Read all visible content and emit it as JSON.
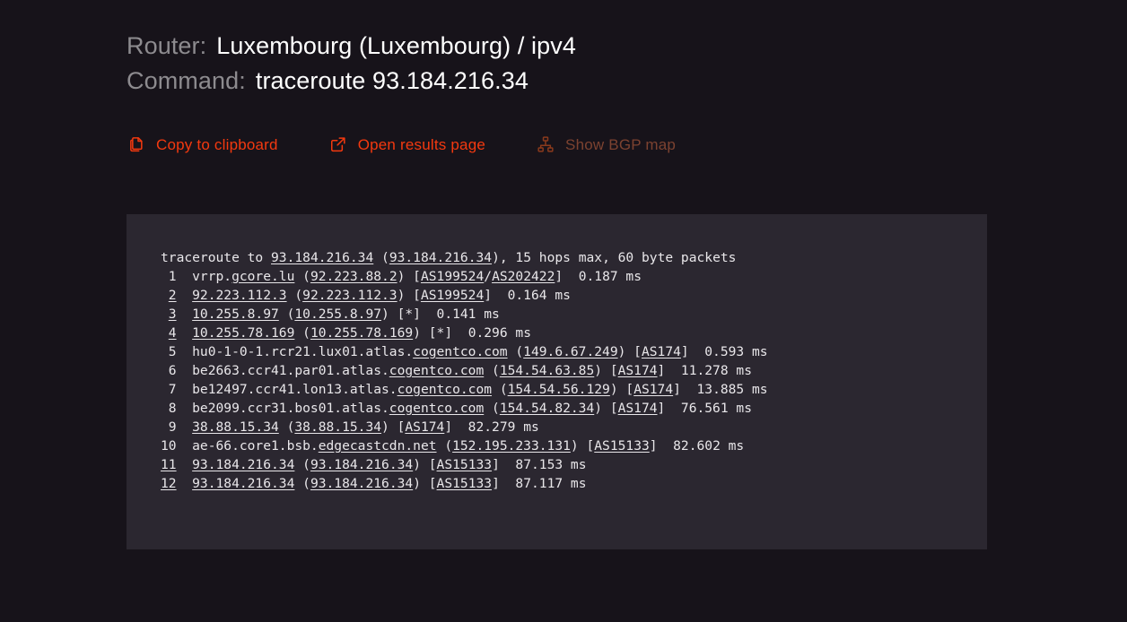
{
  "header": {
    "router_label": "Router:",
    "router_value": "Luxembourg (Luxembourg) / ipv4",
    "command_label": "Command:",
    "command_value": "traceroute 93.184.216.34"
  },
  "actions": [
    {
      "id": "copy-to-clipboard",
      "label": "Copy to clipboard",
      "icon": "copy-icon",
      "enabled": true
    },
    {
      "id": "open-results-page",
      "label": "Open results page",
      "icon": "external-link-icon",
      "enabled": true
    },
    {
      "id": "show-bgp-map",
      "label": "Show BGP map",
      "icon": "sitemap-icon",
      "enabled": false
    }
  ],
  "colors": {
    "page_background": "#17131a",
    "panel_background": "#2b2730",
    "accent": "#f4390f",
    "accent_disabled": "#7c4230",
    "header_label": "#8d8b8f",
    "header_value": "#ffffff",
    "terminal_text": "#e9e7ea"
  },
  "terminal": {
    "header_line": [
      {
        "t": "traceroute to ",
        "link": false
      },
      {
        "t": "93.184.216.34",
        "link": true
      },
      {
        "t": " (",
        "link": false
      },
      {
        "t": "93.184.216.34",
        "link": true
      },
      {
        "t": "), 15 hops max, 60 byte packets",
        "link": false
      }
    ],
    "hops": [
      {
        "num": "1",
        "num_link": false,
        "segments": [
          {
            "t": "vrrp.",
            "link": false
          },
          {
            "t": "gcore.lu",
            "link": true
          },
          {
            "t": " (",
            "link": false
          },
          {
            "t": "92.223.88.2",
            "link": true
          },
          {
            "t": ") [",
            "link": false
          },
          {
            "t": "AS199524",
            "link": true
          },
          {
            "t": "/",
            "link": false
          },
          {
            "t": "AS202422",
            "link": true
          },
          {
            "t": "]  0.187 ms",
            "link": false
          }
        ]
      },
      {
        "num": "2",
        "num_link": true,
        "segments": [
          {
            "t": "92.223.112.3",
            "link": true
          },
          {
            "t": " (",
            "link": false
          },
          {
            "t": "92.223.112.3",
            "link": true
          },
          {
            "t": ") [",
            "link": false
          },
          {
            "t": "AS199524",
            "link": true
          },
          {
            "t": "]  0.164 ms",
            "link": false
          }
        ]
      },
      {
        "num": "3",
        "num_link": true,
        "segments": [
          {
            "t": "10.255.8.97",
            "link": true
          },
          {
            "t": " (",
            "link": false
          },
          {
            "t": "10.255.8.97",
            "link": true
          },
          {
            "t": ") [*]  0.141 ms",
            "link": false
          }
        ]
      },
      {
        "num": "4",
        "num_link": true,
        "segments": [
          {
            "t": "10.255.78.169",
            "link": true
          },
          {
            "t": " (",
            "link": false
          },
          {
            "t": "10.255.78.169",
            "link": true
          },
          {
            "t": ") [*]  0.296 ms",
            "link": false
          }
        ]
      },
      {
        "num": "5",
        "num_link": false,
        "segments": [
          {
            "t": "hu0-1-0-1.rcr21.lux01.atlas.",
            "link": false
          },
          {
            "t": "cogentco.com",
            "link": true
          },
          {
            "t": " (",
            "link": false
          },
          {
            "t": "149.6.67.249",
            "link": true
          },
          {
            "t": ") [",
            "link": false
          },
          {
            "t": "AS174",
            "link": true
          },
          {
            "t": "]  0.593 ms",
            "link": false
          }
        ]
      },
      {
        "num": "6",
        "num_link": false,
        "segments": [
          {
            "t": "be2663.ccr41.par01.atlas.",
            "link": false
          },
          {
            "t": "cogentco.com",
            "link": true
          },
          {
            "t": " (",
            "link": false
          },
          {
            "t": "154.54.63.85",
            "link": true
          },
          {
            "t": ") [",
            "link": false
          },
          {
            "t": "AS174",
            "link": true
          },
          {
            "t": "]  11.278 ms",
            "link": false
          }
        ]
      },
      {
        "num": "7",
        "num_link": false,
        "segments": [
          {
            "t": "be12497.ccr41.lon13.atlas.",
            "link": false
          },
          {
            "t": "cogentco.com",
            "link": true
          },
          {
            "t": " (",
            "link": false
          },
          {
            "t": "154.54.56.129",
            "link": true
          },
          {
            "t": ") [",
            "link": false
          },
          {
            "t": "AS174",
            "link": true
          },
          {
            "t": "]  13.885 ms",
            "link": false
          }
        ]
      },
      {
        "num": "8",
        "num_link": false,
        "segments": [
          {
            "t": "be2099.ccr31.bos01.atlas.",
            "link": false
          },
          {
            "t": "cogentco.com",
            "link": true
          },
          {
            "t": " (",
            "link": false
          },
          {
            "t": "154.54.82.34",
            "link": true
          },
          {
            "t": ") [",
            "link": false
          },
          {
            "t": "AS174",
            "link": true
          },
          {
            "t": "]  76.561 ms",
            "link": false
          }
        ]
      },
      {
        "num": "9",
        "num_link": false,
        "segments": [
          {
            "t": "38.88.15.34",
            "link": true
          },
          {
            "t": " (",
            "link": false
          },
          {
            "t": "38.88.15.34",
            "link": true
          },
          {
            "t": ") [",
            "link": false
          },
          {
            "t": "AS174",
            "link": true
          },
          {
            "t": "]  82.279 ms",
            "link": false
          }
        ]
      },
      {
        "num": "10",
        "num_link": false,
        "segments": [
          {
            "t": "ae-66.core1.bsb.",
            "link": false
          },
          {
            "t": "edgecastcdn.net",
            "link": true
          },
          {
            "t": " (",
            "link": false
          },
          {
            "t": "152.195.233.131",
            "link": true
          },
          {
            "t": ") [",
            "link": false
          },
          {
            "t": "AS15133",
            "link": true
          },
          {
            "t": "]  82.602 ms",
            "link": false
          }
        ]
      },
      {
        "num": "11",
        "num_link": true,
        "segments": [
          {
            "t": "93.184.216.34",
            "link": true
          },
          {
            "t": " (",
            "link": false
          },
          {
            "t": "93.184.216.34",
            "link": true
          },
          {
            "t": ") [",
            "link": false
          },
          {
            "t": "AS15133",
            "link": true
          },
          {
            "t": "]  87.153 ms",
            "link": false
          }
        ]
      },
      {
        "num": "12",
        "num_link": true,
        "segments": [
          {
            "t": "93.184.216.34",
            "link": true
          },
          {
            "t": " (",
            "link": false
          },
          {
            "t": "93.184.216.34",
            "link": true
          },
          {
            "t": ") [",
            "link": false
          },
          {
            "t": "AS15133",
            "link": true
          },
          {
            "t": "]  87.117 ms",
            "link": false
          }
        ]
      }
    ]
  }
}
